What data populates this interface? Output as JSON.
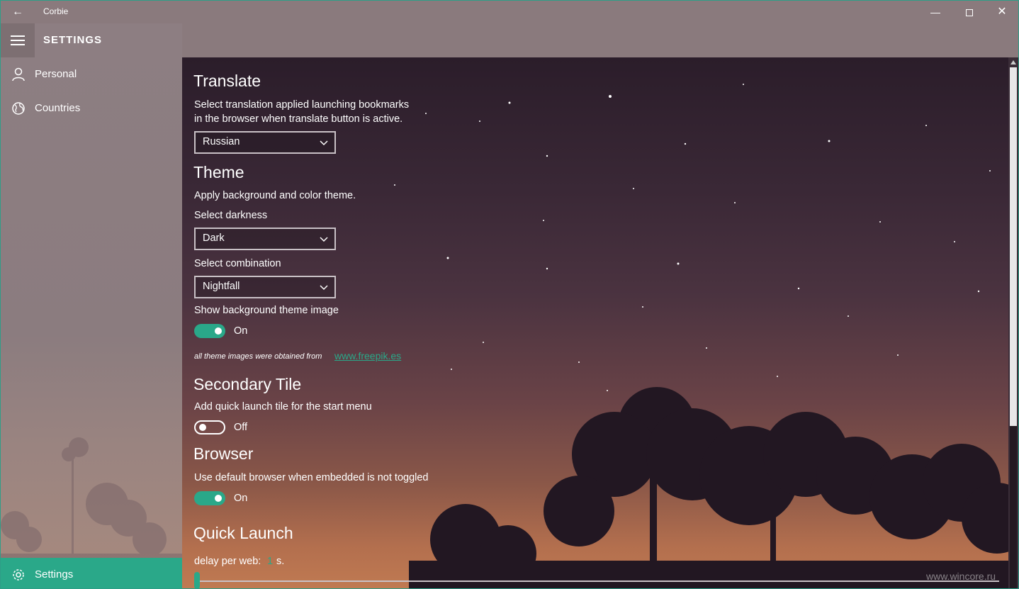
{
  "window": {
    "title": "Corbie",
    "back_icon": "←",
    "controls": {
      "minimize": "—",
      "close": "✕"
    }
  },
  "sidebar": {
    "title": "SETTINGS",
    "items": [
      {
        "label": "Personal",
        "icon": "person-icon"
      },
      {
        "label": "Countries",
        "icon": "globe-icon"
      }
    ],
    "footer": {
      "label": "Settings",
      "icon": "gear-icon"
    }
  },
  "translate": {
    "heading": "Translate",
    "description_line1": "Select translation applied launching bookmarks",
    "description_line2": "in the browser when translate button is active.",
    "selected": "Russian"
  },
  "theme": {
    "heading": "Theme",
    "description": "Apply background and color theme.",
    "darkness_label": "Select darkness",
    "darkness_value": "Dark",
    "combination_label": "Select combination",
    "combination_value": "Nightfall",
    "bg_image_label": "Show background theme image",
    "bg_image_state": "On",
    "credit_text": "all theme images were obtained from",
    "credit_link": "www.freepik.es"
  },
  "secondary_tile": {
    "heading": "Secondary Tile",
    "description": "Add quick launch tile for the start menu",
    "state": "Off"
  },
  "browser": {
    "heading": "Browser",
    "description": "Use default browser when embedded is not toggled",
    "state": "On"
  },
  "quick_launch": {
    "heading": "Quick Launch",
    "delay_label": "delay per web:",
    "delay_value": "1",
    "delay_unit": "s."
  },
  "watermark": "www.wincore.ru",
  "colors": {
    "accent": "#2aa889",
    "titlebar": "#8a7a7d"
  }
}
